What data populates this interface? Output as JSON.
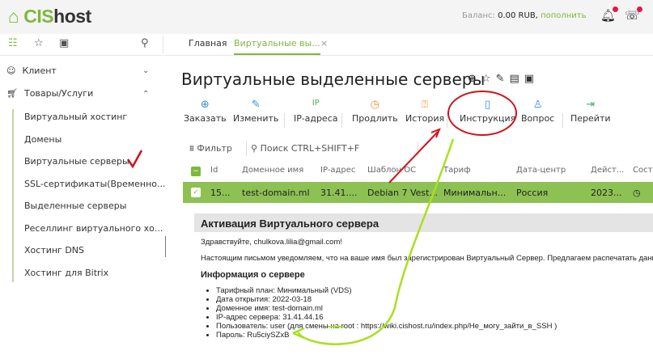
{
  "header": {
    "logo": "CIShost",
    "balance_label": "Баланс:",
    "balance_value": "0.00 RUB,",
    "topup_link": "пополнить"
  },
  "tabs": [
    {
      "label": "Главная"
    },
    {
      "label": "Виртуальные вы..."
    }
  ],
  "sidebar": {
    "groups": [
      {
        "label": "Клиент"
      },
      {
        "label": "Товары/Услуги"
      }
    ],
    "items": [
      "Виртуальный хостинг",
      "Домены",
      "Виртуальные серверы",
      "SSL-сертификаты(Временно...",
      "Выделенные серверы",
      "Реселлинг виртуального хо...",
      "Хостинг DNS",
      "Хостинг для Bitrix"
    ]
  },
  "page": {
    "title": "Виртуальные выделенные серверы"
  },
  "toolbar": [
    "Заказать",
    "Изменить",
    "IP-адреса",
    "Продлить",
    "История",
    "Инструкция",
    "Вопрос",
    "Перейти"
  ],
  "filter": {
    "label": "Фильтр",
    "search_placeholder": "Поиск CTRL+SHIFT+F"
  },
  "table": {
    "columns": [
      "Id",
      "Доменное имя",
      "IP-адрес",
      "Шаблон ОС",
      "Тариф",
      "Дата-центр",
      "Дейст...",
      "Состо"
    ],
    "rows": [
      [
        "15...",
        "test-domain.ml",
        "31.41....",
        "Debian 7 Vest...",
        "Минимальн...",
        "Россия",
        "2023..."
      ]
    ]
  },
  "mail": {
    "title": "Активация Виртуального сервера",
    "greeting": "Здравствуйте, chulkova.lilia@gmail.com!",
    "body": "Настоящим письмом уведомляем, что на ваше имя был зарегистрирован Виртуальный Сервер. Предлагаем распечатать данное с",
    "section": "Информация о сервере",
    "items": [
      "Тарифный план: Минимальный (VDS)",
      "Дата открытия: 2022-03-18",
      "Доменное имя: test-domain.ml",
      "IP-адрес сервера: 31.41.44.16",
      "Пользователь: user (для смены на root : https://wiki.cishost.ru/index.php/Не_могу_зайти_в_SSH )",
      "Пароль: Ru5ciySZxB"
    ]
  },
  "colors": {
    "accent": "#7cb83a",
    "selected_row": "#8dc153",
    "annotation_red": "#d0121b",
    "annotation_green": "#a8e020"
  }
}
